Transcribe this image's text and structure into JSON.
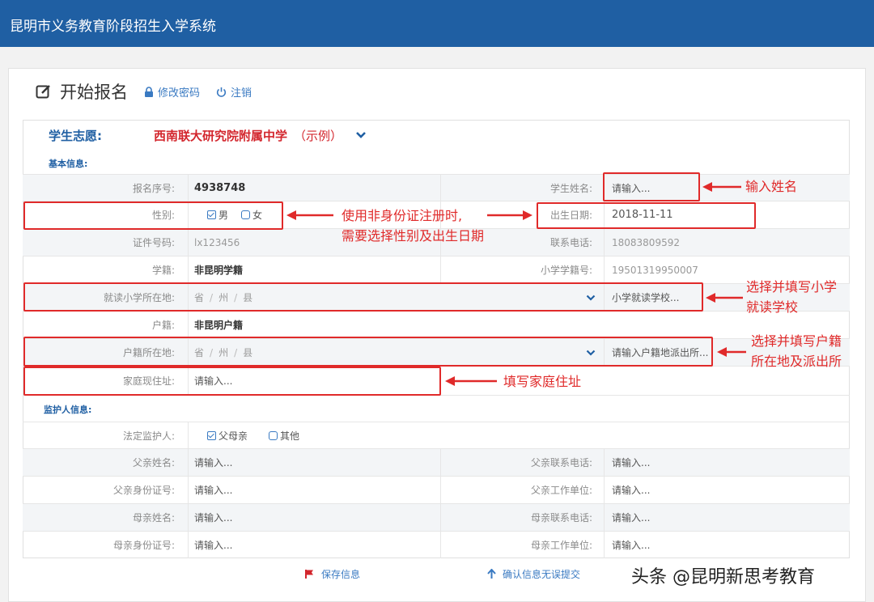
{
  "app": {
    "title": "昆明市义务教育阶段招生入学系统"
  },
  "header": {
    "title": "开始报名",
    "change_password": "修改密码",
    "logout": "注销"
  },
  "preference": {
    "label": "学生志愿:",
    "value": "西南联大研究院附属中学",
    "note": "（示例）"
  },
  "sections": {
    "basic": "基本信息:",
    "guardian": "监护人信息:"
  },
  "basic": {
    "serial_label": "报名序号:",
    "serial_value": "4938748",
    "name_label": "学生姓名:",
    "name_placeholder": "请输入...",
    "gender_label": "性别:",
    "gender_male": "男",
    "gender_female": "女",
    "birth_label": "出生日期:",
    "birth_value": "2018-11-11",
    "id_label": "证件号码:",
    "id_value": "lx123456",
    "phone_label": "联系电话:",
    "phone_value": "18083809592",
    "school_status_label": "学籍:",
    "school_status_value": "非昆明学籍",
    "primary_no_label": "小学学籍号:",
    "primary_no_value": "19501319950007",
    "primary_loc_label": "就读小学所在地:",
    "province": "省",
    "prefecture": "州",
    "county": "县",
    "primary_school_placeholder": "小学就读学校...",
    "hukou_label": "户籍:",
    "hukou_value": "非昆明户籍",
    "hukou_loc_label": "户籍所在地:",
    "police_placeholder": "请输入户籍地派出所...",
    "address_label": "家庭现住址:",
    "address_placeholder": "请输入..."
  },
  "guardian": {
    "legal_label": "法定监护人:",
    "parents": "父母亲",
    "other": "其他",
    "father_name_label": "父亲姓名:",
    "father_phone_label": "父亲联系电话:",
    "father_id_label": "父亲身份证号:",
    "father_work_label": "父亲工作单位:",
    "mother_name_label": "母亲姓名:",
    "mother_phone_label": "母亲联系电话:",
    "mother_id_label": "母亲身份证号:",
    "mother_work_label": "母亲工作单位:",
    "placeholder": "请输入..."
  },
  "footer": {
    "save": "保存信息",
    "submit": "确认信息无误提交"
  },
  "annotations": {
    "name": "输入姓名",
    "gender_birth_1": "使用非身份证注册时,",
    "gender_birth_2": "需要选择性别及出生日期",
    "school_1": "选择并填写小学",
    "school_2": "就读学校",
    "hukou_1": "选择并填写户籍",
    "hukou_2": "所在地及派出所",
    "address": "填写家庭住址"
  },
  "watermark": "头条 @昆明新思考教育",
  "colors": {
    "topbar": "#1f5fa3",
    "accent": "#3a7ac2",
    "annotation": "#e02a2a",
    "preference": "#d3262d"
  }
}
